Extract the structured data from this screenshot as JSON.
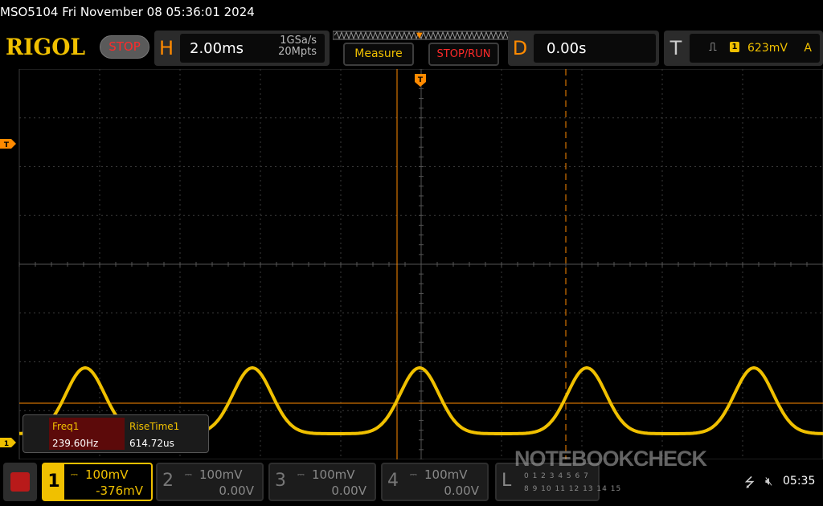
{
  "title_bar": {
    "text": "MSO5104  Fri November 08 05:36:01 2024"
  },
  "logo": {
    "text": "RIGOL"
  },
  "run_state": {
    "label": "STOP"
  },
  "horizontal": {
    "letter": "H",
    "scale": "2.00ms",
    "sample_rate": "1GSa/s",
    "memory_depth": "20Mpts"
  },
  "buttons": {
    "measure": "Measure",
    "stop_run": "STOP/RUN"
  },
  "delay": {
    "letter": "D",
    "value": "0.00s"
  },
  "trigger": {
    "letter": "T",
    "source": "1",
    "level": "623mV",
    "mode": "A"
  },
  "markers": {
    "trigger_time": "T",
    "trigger_level": "T",
    "ch1_ground": "1"
  },
  "measurements": [
    {
      "name": "Freq1",
      "value": "239.60Hz"
    },
    {
      "name": "RiseTime1",
      "value": "614.72us"
    }
  ],
  "channels": [
    {
      "num": "1",
      "scale": "100mV",
      "offset": "-376mV",
      "active": true
    },
    {
      "num": "2",
      "scale": "100mV",
      "offset": "0.00V",
      "active": false
    },
    {
      "num": "3",
      "scale": "100mV",
      "offset": "0.00V",
      "active": false
    },
    {
      "num": "4",
      "scale": "100mV",
      "offset": "0.00V",
      "active": false
    }
  ],
  "logic": {
    "letter": "L",
    "row1": "0 1 2 3 4 5 6 7",
    "row2": "8 9 10 11 12 13 14 15"
  },
  "watermark": {
    "text": "NOTEBOOKCHECK"
  },
  "status": {
    "clock": "05:35"
  },
  "colors": {
    "ch1": "#f0c000",
    "accent": "#ff8a00",
    "stop": "#ff2a2a",
    "grid": "#3a3a3a"
  },
  "icons": {
    "menu": "grid-menu-icon",
    "usb": "usb-icon",
    "volume": "muted-speaker-icon",
    "trigger_slope": "rising-edge-icon"
  }
}
